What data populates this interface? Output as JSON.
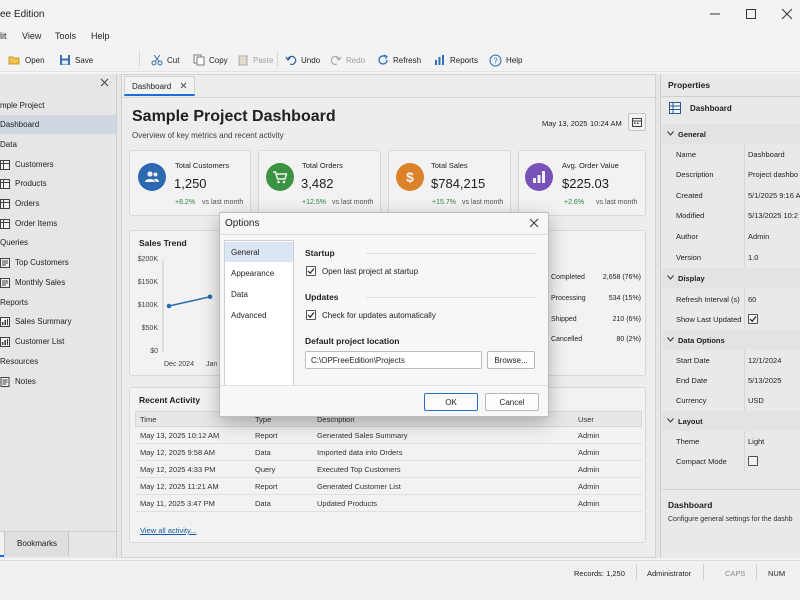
{
  "window": {
    "title": "ee Edition"
  },
  "menu": [
    "lit",
    "View",
    "Tools",
    "Help"
  ],
  "toolbar": {
    "open": "Open",
    "save": "Save",
    "cut": "Cut",
    "copy": "Copy",
    "paste": "Paste",
    "undo": "Undo",
    "redo": "Redo",
    "refresh": "Refresh",
    "reports": "Reports",
    "help": "Help"
  },
  "sidebar": {
    "items": [
      {
        "label": "mple Project"
      },
      {
        "label": "Dashboard"
      },
      {
        "label": "Data"
      },
      {
        "label": "Customers"
      },
      {
        "label": "Products"
      },
      {
        "label": "Orders"
      },
      {
        "label": "Order Items"
      },
      {
        "label": "Queries"
      },
      {
        "label": "Top Customers"
      },
      {
        "label": "Monthly Sales"
      },
      {
        "label": "Reports"
      },
      {
        "label": "Sales Summary"
      },
      {
        "label": "Customer List"
      },
      {
        "label": "Resources"
      },
      {
        "label": "Notes"
      }
    ],
    "bookmarks_tab": "Bookmarks"
  },
  "tab": {
    "label": "Dashboard"
  },
  "dashboard": {
    "title": "Sample Project Dashboard",
    "subtitle": "Overview of key metrics and recent activity",
    "date": "May 13, 2025",
    "time": "10:24 AM"
  },
  "kpis": [
    {
      "label": "Total Customers",
      "value": "1,250",
      "delta": "+8.2%",
      "note": "vs last month",
      "color": "#2f6fba"
    },
    {
      "label": "Total Orders",
      "value": "3,482",
      "delta": "+12.5%",
      "note": "vs last month",
      "color": "#3d9b47"
    },
    {
      "label": "Total Sales",
      "value": "$784,215",
      "delta": "+15.7%",
      "note": "vs last month",
      "color": "#e88a2e"
    },
    {
      "label": "Avg. Order Value",
      "value": "$225.03",
      "delta": "+2.6%",
      "note": "vs last month",
      "color": "#7e57c2"
    }
  ],
  "sales_trend": {
    "title": "Sales Trend",
    "y_ticks": [
      "$200K",
      "$150K",
      "$100K",
      "$50K",
      "$0"
    ],
    "x_ticks": [
      "Dec 2024",
      "Jan"
    ]
  },
  "chart_data": {
    "type": "line",
    "title": "Sales Trend",
    "x": [
      "Dec 2024",
      "Jan"
    ],
    "values": [
      100000,
      120000
    ],
    "ylim": [
      0,
      200000
    ]
  },
  "status_breakdown": [
    {
      "label": "Completed",
      "value": "2,658 (76%)"
    },
    {
      "label": "Processing",
      "value": "534 (15%)"
    },
    {
      "label": "Shipped",
      "value": "210 (6%)"
    },
    {
      "label": "Cancelled",
      "value": "80 (2%)"
    }
  ],
  "activity": {
    "title": "Recent Activity",
    "columns": [
      "Time",
      "Type",
      "Description",
      "User"
    ],
    "rows": [
      {
        "time": "May 13, 2025 10:12 AM",
        "type": "Report",
        "desc": "Generated Sales Summary",
        "user": "Admin"
      },
      {
        "time": "May 12, 2025 9:58 AM",
        "type": "Data",
        "desc": "Imported data into Orders",
        "user": "Admin"
      },
      {
        "time": "May 12, 2025 4:33 PM",
        "type": "Query",
        "desc": "Executed Top Customers",
        "user": "Admin"
      },
      {
        "time": "May 12, 2025 11:21 AM",
        "type": "Report",
        "desc": "Generated Customer List",
        "user": "Admin"
      },
      {
        "time": "May 11, 2025 3:47 PM",
        "type": "Data",
        "desc": "Updated Products",
        "user": "Admin"
      }
    ],
    "view_all": "View all activity..."
  },
  "properties": {
    "title": "Properties",
    "object": "Dashboard",
    "general_label": "General",
    "general": [
      {
        "k": "Name",
        "v": "Dashboard"
      },
      {
        "k": "Description",
        "v": "Project dashbo"
      },
      {
        "k": "Created",
        "v": "5/1/2025 9:16 A"
      },
      {
        "k": "Modified",
        "v": "5/13/2025 10:2"
      },
      {
        "k": "Author",
        "v": "Admin"
      },
      {
        "k": "Version",
        "v": "1.0"
      }
    ],
    "display_label": "Display",
    "refresh_label": "Refresh Interval (s)",
    "refresh_value": "60",
    "show_last_label": "Show Last Updated",
    "data_options_label": "Data Options",
    "data_options": [
      {
        "k": "Start Date",
        "v": "12/1/2024"
      },
      {
        "k": "End Date",
        "v": "5/13/2025"
      },
      {
        "k": "Currency",
        "v": "USD"
      }
    ],
    "layout_label": "Layout",
    "theme_label": "Theme",
    "theme_value": "Light",
    "compact_label": "Compact Mode",
    "help_title": "Dashboard",
    "help_text": "Configure general settings for the dashb"
  },
  "dialog": {
    "title": "Options",
    "nav": [
      "General",
      "Appearance",
      "Data",
      "Advanced"
    ],
    "startup_header": "Startup",
    "open_last": "Open last project at startup",
    "updates_header": "Updates",
    "check_updates": "Check for updates automatically",
    "default_location_header": "Default project location",
    "location_value": "C:\\OPFreeEdition\\Projects",
    "browse": "Browse...",
    "ok": "OK",
    "cancel": "Cancel"
  },
  "status": {
    "records": "Records: 1,250",
    "user": "Administrator",
    "caps": "CAPS",
    "num": "NUM"
  }
}
